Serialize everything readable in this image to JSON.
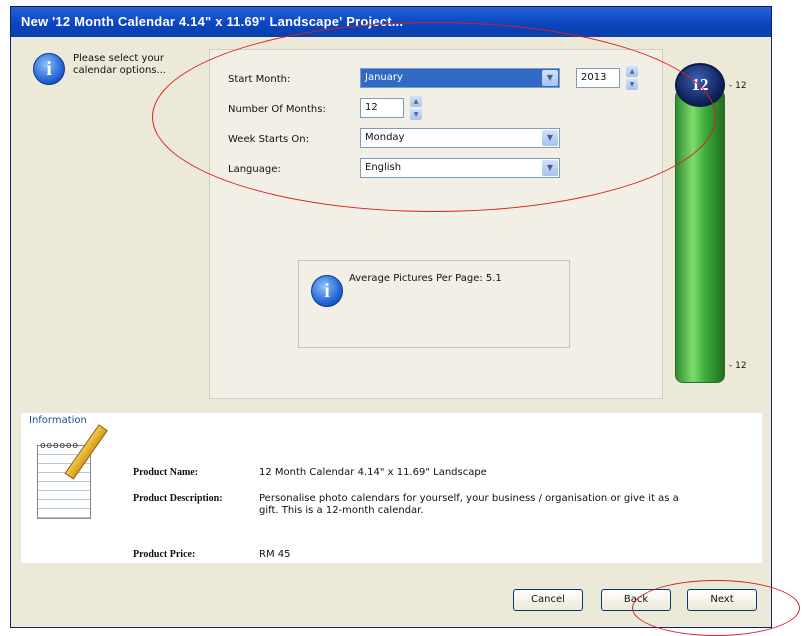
{
  "window": {
    "title": "New '12 Month Calendar  4.14\" x 11.69\" Landscape' Project..."
  },
  "prompt": {
    "text": "Please select your calendar options..."
  },
  "form": {
    "start_month_label": "Start Month:",
    "start_month_value": "January",
    "year_value": "2013",
    "num_months_label": "Number Of Months:",
    "num_months_value": "12",
    "week_starts_label": "Week Starts On:",
    "week_starts_value": "Monday",
    "language_label": "Language:",
    "language_value": "English"
  },
  "average": {
    "text": "Average Pictures Per Page: 5.1"
  },
  "gauge": {
    "cap_value": "12",
    "top_label": "- 12",
    "bottom_label": "- 12"
  },
  "info": {
    "title": "Information",
    "name_label": "Product Name:",
    "name_value": "12 Month Calendar  4.14\" x 11.69\" Landscape",
    "desc_label": "Product Description:",
    "desc_value": "Personalise photo calendars for yourself, your business / organisation or give it as a gift.  This is a 12-month calendar.",
    "price_label": "Product Price:",
    "price_value": "RM 45"
  },
  "buttons": {
    "cancel": "Cancel",
    "back": "Back",
    "next": "Next"
  },
  "icons": {
    "info": "info-icon",
    "notepad": "notepad-pencil-icon",
    "dropdown": "dropdown-arrow-icon"
  }
}
